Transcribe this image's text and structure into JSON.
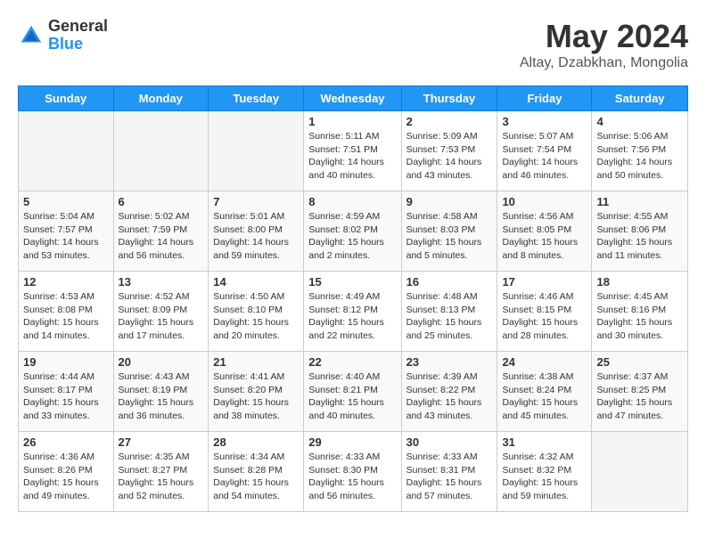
{
  "logo": {
    "general": "General",
    "blue": "Blue"
  },
  "header": {
    "month_year": "May 2024",
    "location": "Altay, Dzabkhan, Mongolia"
  },
  "weekdays": [
    "Sunday",
    "Monday",
    "Tuesday",
    "Wednesday",
    "Thursday",
    "Friday",
    "Saturday"
  ],
  "weeks": [
    [
      {
        "day": "",
        "sunrise": "",
        "sunset": "",
        "daylight": ""
      },
      {
        "day": "",
        "sunrise": "",
        "sunset": "",
        "daylight": ""
      },
      {
        "day": "",
        "sunrise": "",
        "sunset": "",
        "daylight": ""
      },
      {
        "day": "1",
        "sunrise": "Sunrise: 5:11 AM",
        "sunset": "Sunset: 7:51 PM",
        "daylight": "Daylight: 14 hours and 40 minutes."
      },
      {
        "day": "2",
        "sunrise": "Sunrise: 5:09 AM",
        "sunset": "Sunset: 7:53 PM",
        "daylight": "Daylight: 14 hours and 43 minutes."
      },
      {
        "day": "3",
        "sunrise": "Sunrise: 5:07 AM",
        "sunset": "Sunset: 7:54 PM",
        "daylight": "Daylight: 14 hours and 46 minutes."
      },
      {
        "day": "4",
        "sunrise": "Sunrise: 5:06 AM",
        "sunset": "Sunset: 7:56 PM",
        "daylight": "Daylight: 14 hours and 50 minutes."
      }
    ],
    [
      {
        "day": "5",
        "sunrise": "Sunrise: 5:04 AM",
        "sunset": "Sunset: 7:57 PM",
        "daylight": "Daylight: 14 hours and 53 minutes."
      },
      {
        "day": "6",
        "sunrise": "Sunrise: 5:02 AM",
        "sunset": "Sunset: 7:59 PM",
        "daylight": "Daylight: 14 hours and 56 minutes."
      },
      {
        "day": "7",
        "sunrise": "Sunrise: 5:01 AM",
        "sunset": "Sunset: 8:00 PM",
        "daylight": "Daylight: 14 hours and 59 minutes."
      },
      {
        "day": "8",
        "sunrise": "Sunrise: 4:59 AM",
        "sunset": "Sunset: 8:02 PM",
        "daylight": "Daylight: 15 hours and 2 minutes."
      },
      {
        "day": "9",
        "sunrise": "Sunrise: 4:58 AM",
        "sunset": "Sunset: 8:03 PM",
        "daylight": "Daylight: 15 hours and 5 minutes."
      },
      {
        "day": "10",
        "sunrise": "Sunrise: 4:56 AM",
        "sunset": "Sunset: 8:05 PM",
        "daylight": "Daylight: 15 hours and 8 minutes."
      },
      {
        "day": "11",
        "sunrise": "Sunrise: 4:55 AM",
        "sunset": "Sunset: 8:06 PM",
        "daylight": "Daylight: 15 hours and 11 minutes."
      }
    ],
    [
      {
        "day": "12",
        "sunrise": "Sunrise: 4:53 AM",
        "sunset": "Sunset: 8:08 PM",
        "daylight": "Daylight: 15 hours and 14 minutes."
      },
      {
        "day": "13",
        "sunrise": "Sunrise: 4:52 AM",
        "sunset": "Sunset: 8:09 PM",
        "daylight": "Daylight: 15 hours and 17 minutes."
      },
      {
        "day": "14",
        "sunrise": "Sunrise: 4:50 AM",
        "sunset": "Sunset: 8:10 PM",
        "daylight": "Daylight: 15 hours and 20 minutes."
      },
      {
        "day": "15",
        "sunrise": "Sunrise: 4:49 AM",
        "sunset": "Sunset: 8:12 PM",
        "daylight": "Daylight: 15 hours and 22 minutes."
      },
      {
        "day": "16",
        "sunrise": "Sunrise: 4:48 AM",
        "sunset": "Sunset: 8:13 PM",
        "daylight": "Daylight: 15 hours and 25 minutes."
      },
      {
        "day": "17",
        "sunrise": "Sunrise: 4:46 AM",
        "sunset": "Sunset: 8:15 PM",
        "daylight": "Daylight: 15 hours and 28 minutes."
      },
      {
        "day": "18",
        "sunrise": "Sunrise: 4:45 AM",
        "sunset": "Sunset: 8:16 PM",
        "daylight": "Daylight: 15 hours and 30 minutes."
      }
    ],
    [
      {
        "day": "19",
        "sunrise": "Sunrise: 4:44 AM",
        "sunset": "Sunset: 8:17 PM",
        "daylight": "Daylight: 15 hours and 33 minutes."
      },
      {
        "day": "20",
        "sunrise": "Sunrise: 4:43 AM",
        "sunset": "Sunset: 8:19 PM",
        "daylight": "Daylight: 15 hours and 36 minutes."
      },
      {
        "day": "21",
        "sunrise": "Sunrise: 4:41 AM",
        "sunset": "Sunset: 8:20 PM",
        "daylight": "Daylight: 15 hours and 38 minutes."
      },
      {
        "day": "22",
        "sunrise": "Sunrise: 4:40 AM",
        "sunset": "Sunset: 8:21 PM",
        "daylight": "Daylight: 15 hours and 40 minutes."
      },
      {
        "day": "23",
        "sunrise": "Sunrise: 4:39 AM",
        "sunset": "Sunset: 8:22 PM",
        "daylight": "Daylight: 15 hours and 43 minutes."
      },
      {
        "day": "24",
        "sunrise": "Sunrise: 4:38 AM",
        "sunset": "Sunset: 8:24 PM",
        "daylight": "Daylight: 15 hours and 45 minutes."
      },
      {
        "day": "25",
        "sunrise": "Sunrise: 4:37 AM",
        "sunset": "Sunset: 8:25 PM",
        "daylight": "Daylight: 15 hours and 47 minutes."
      }
    ],
    [
      {
        "day": "26",
        "sunrise": "Sunrise: 4:36 AM",
        "sunset": "Sunset: 8:26 PM",
        "daylight": "Daylight: 15 hours and 49 minutes."
      },
      {
        "day": "27",
        "sunrise": "Sunrise: 4:35 AM",
        "sunset": "Sunset: 8:27 PM",
        "daylight": "Daylight: 15 hours and 52 minutes."
      },
      {
        "day": "28",
        "sunrise": "Sunrise: 4:34 AM",
        "sunset": "Sunset: 8:28 PM",
        "daylight": "Daylight: 15 hours and 54 minutes."
      },
      {
        "day": "29",
        "sunrise": "Sunrise: 4:33 AM",
        "sunset": "Sunset: 8:30 PM",
        "daylight": "Daylight: 15 hours and 56 minutes."
      },
      {
        "day": "30",
        "sunrise": "Sunrise: 4:33 AM",
        "sunset": "Sunset: 8:31 PM",
        "daylight": "Daylight: 15 hours and 57 minutes."
      },
      {
        "day": "31",
        "sunrise": "Sunrise: 4:32 AM",
        "sunset": "Sunset: 8:32 PM",
        "daylight": "Daylight: 15 hours and 59 minutes."
      },
      {
        "day": "",
        "sunrise": "",
        "sunset": "",
        "daylight": ""
      }
    ]
  ]
}
